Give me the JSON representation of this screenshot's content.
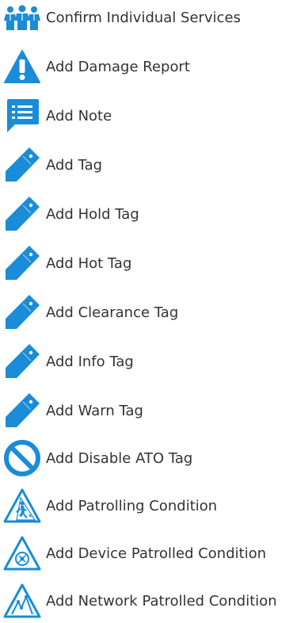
{
  "colors": {
    "accent": "#1a8cd8",
    "text": "#333333"
  },
  "menu": {
    "items": [
      {
        "label": "Confirm Individual Services",
        "icon": "people-group-icon"
      },
      {
        "label": "Add Damage Report",
        "icon": "warning-triangle-icon"
      },
      {
        "label": "Add Note",
        "icon": "note-bubble-icon"
      },
      {
        "label": "Add Tag",
        "icon": "tag-icon"
      },
      {
        "label": "Add Hold Tag",
        "icon": "tag-icon"
      },
      {
        "label": "Add Hot Tag",
        "icon": "tag-icon"
      },
      {
        "label": "Add Clearance Tag",
        "icon": "tag-icon"
      },
      {
        "label": "Add Info Tag",
        "icon": "tag-icon"
      },
      {
        "label": "Add Warn Tag",
        "icon": "tag-icon"
      },
      {
        "label": "Add Disable ATO Tag",
        "icon": "prohibited-icon"
      },
      {
        "label": "Add Patrolling Condition",
        "icon": "patrol-triangle-icon"
      },
      {
        "label": "Add Device Patrolled Condition",
        "icon": "device-patrol-triangle-icon"
      },
      {
        "label": "Add Network Patrolled Condition",
        "icon": "network-patrol-triangle-icon"
      }
    ]
  }
}
